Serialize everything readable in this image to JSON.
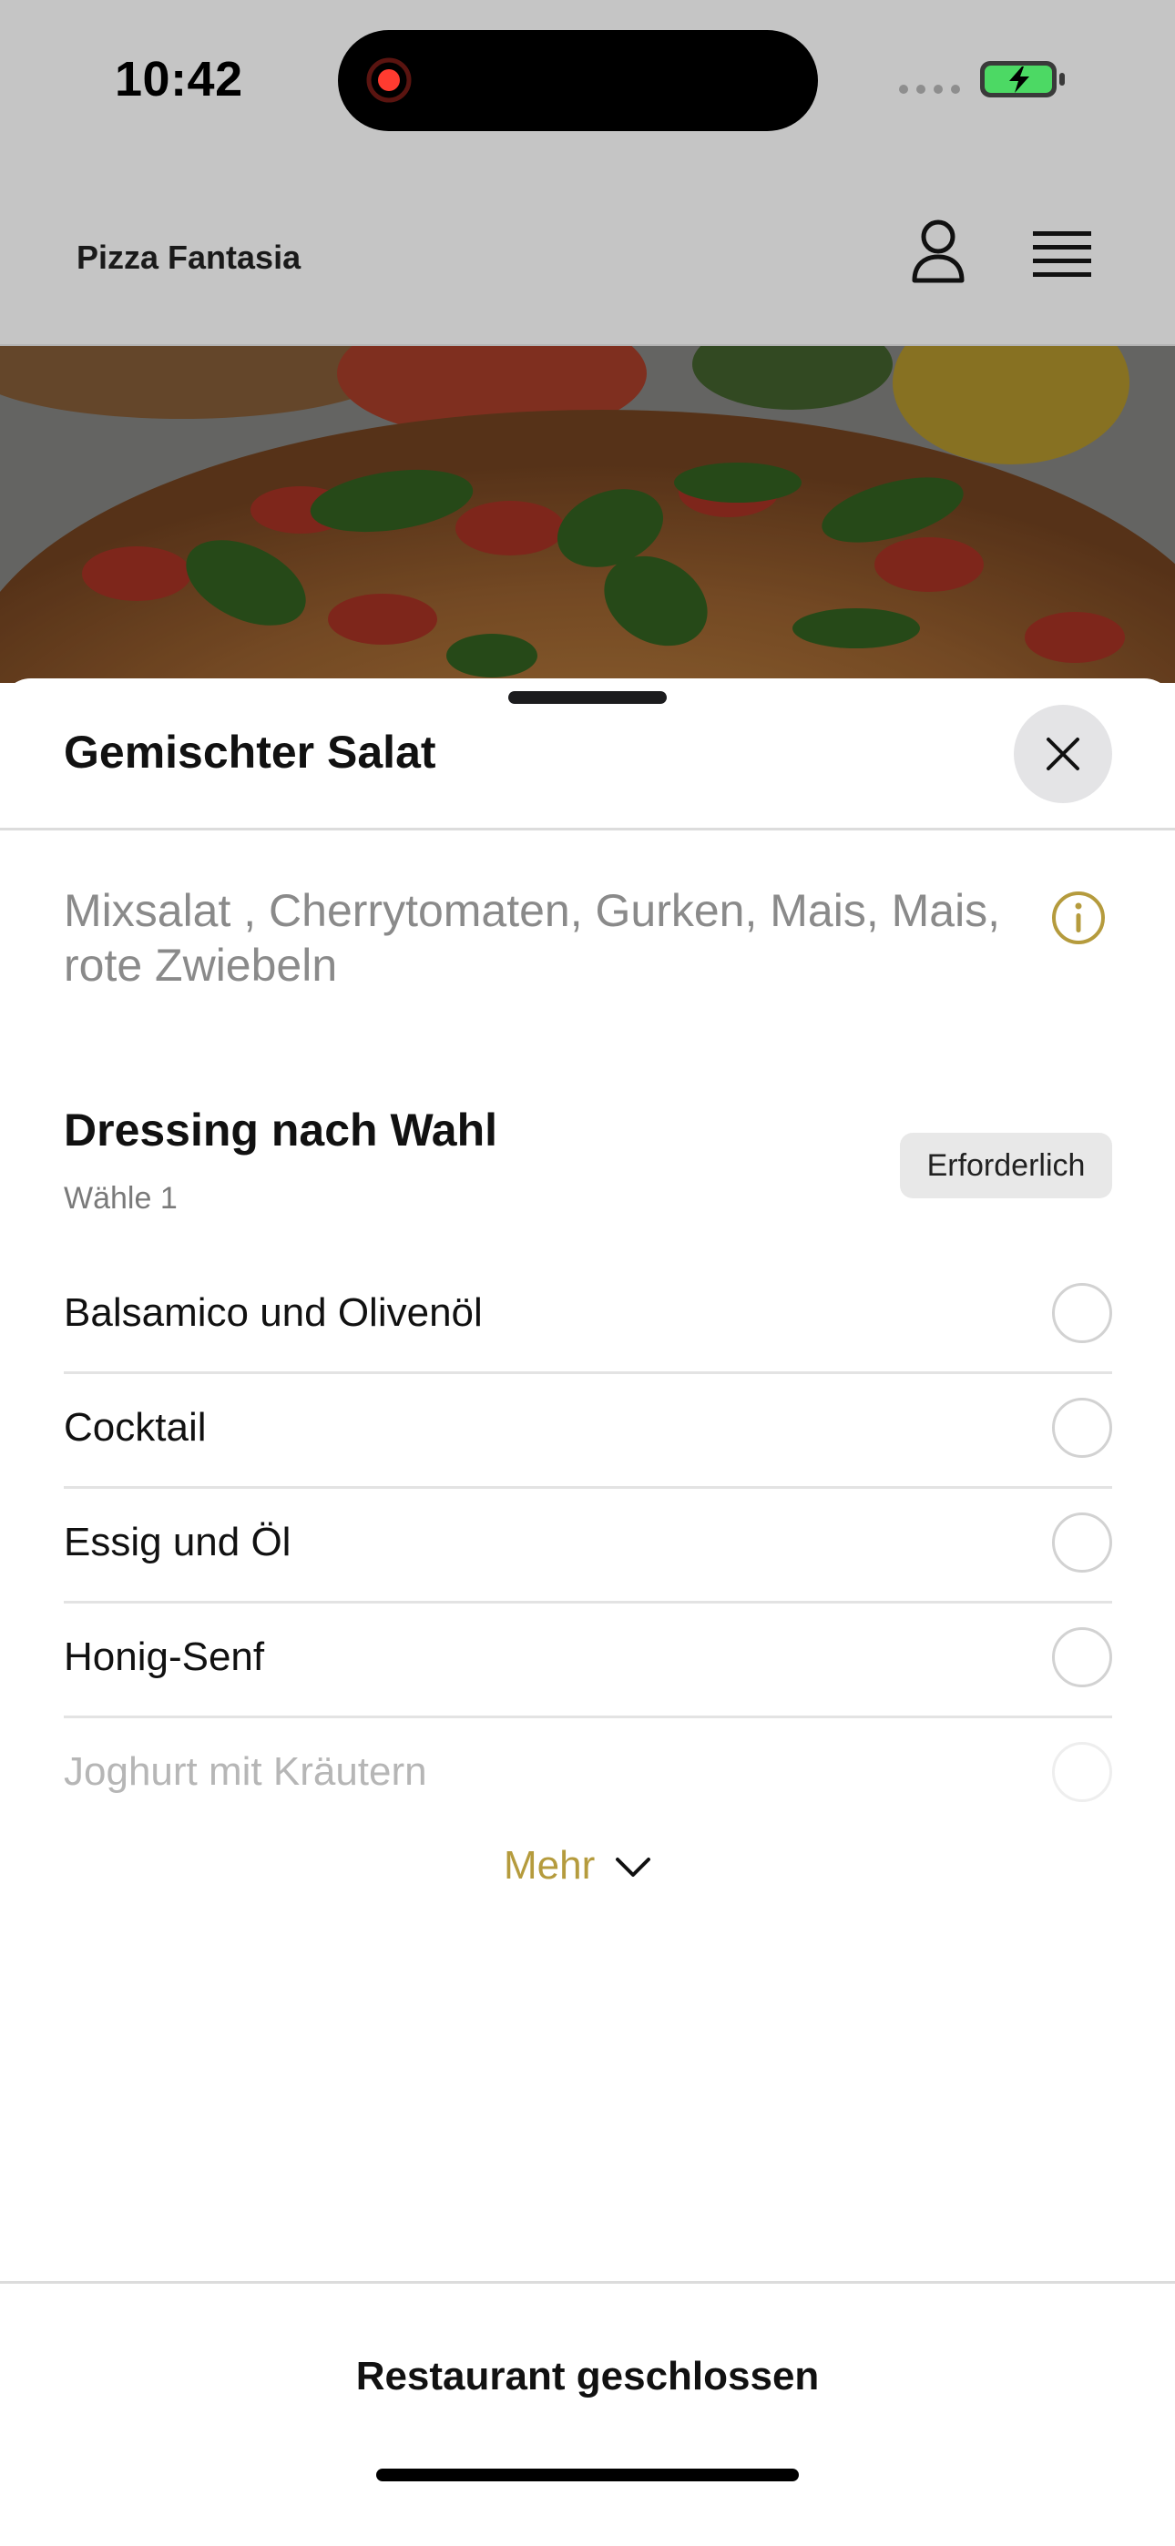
{
  "status_bar": {
    "time": "10:42",
    "battery_icon": "battery-charging-icon",
    "signal_icon": "cellular-signal-icon",
    "record_icon": "screen-recording-icon"
  },
  "header": {
    "restaurant_name": "Pizza Fantasia",
    "account_icon": "person-icon",
    "menu_icon": "hamburger-menu-icon"
  },
  "sheet": {
    "title": "Gemischter Salat",
    "close_icon": "close-icon",
    "description": "Mixsalat , Cherrytomaten, Gurken, Mais, Mais, rote Zwiebeln",
    "info_icon": "info-icon",
    "option_group": {
      "title": "Dressing nach Wahl",
      "subtitle": "Wähle 1",
      "badge": "Erforderlich",
      "options": [
        {
          "label": "Balsamico und Olivenöl",
          "selected": false
        },
        {
          "label": "Cocktail",
          "selected": false
        },
        {
          "label": "Essig und Öl",
          "selected": false
        },
        {
          "label": "Honig-Senf",
          "selected": false
        },
        {
          "label": "Joghurt mit Kräutern",
          "selected": false
        }
      ]
    },
    "more_label": "Mehr",
    "more_icon": "chevron-down-icon",
    "footer_status": "Restaurant geschlossen"
  },
  "colors": {
    "accent": "#b59b3d",
    "dim_overlay": "#c5c5c5",
    "recording_red": "#ff3b30",
    "battery_green": "#4cd964"
  }
}
